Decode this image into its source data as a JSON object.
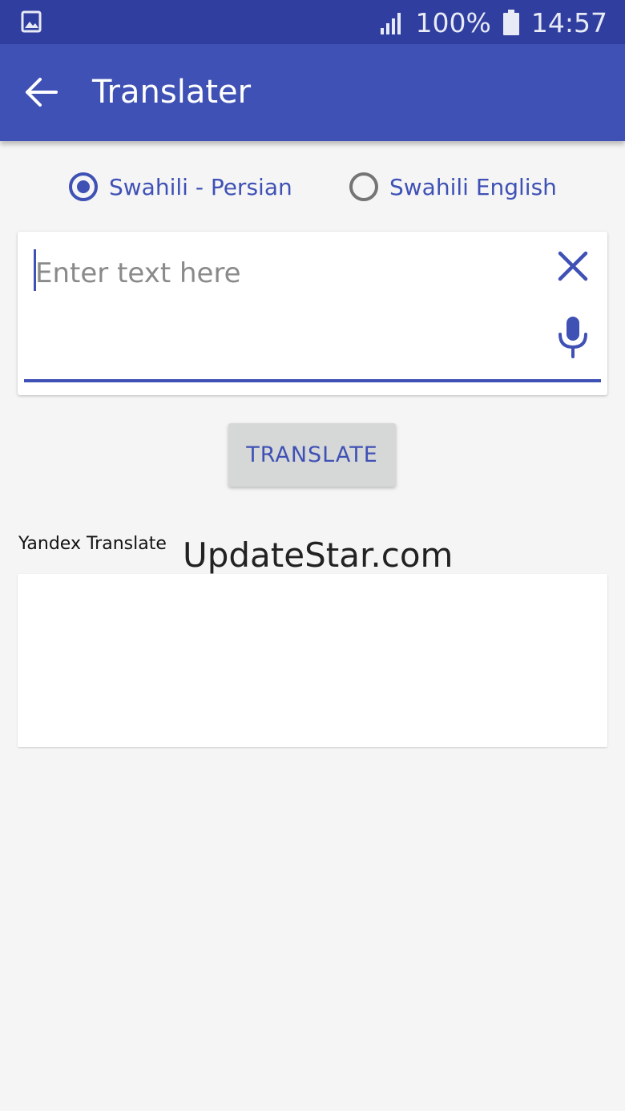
{
  "status_bar": {
    "left_icon": "image-notification-icon",
    "signal_icon": "cellular-signal-icon",
    "battery_percent": "100%",
    "battery_icon": "battery-full-icon",
    "time": "14:57"
  },
  "app_bar": {
    "back_icon": "arrow-back-icon",
    "title": "Translater",
    "color": "#3f51b5",
    "status_color": "#303f9f"
  },
  "language_options": [
    {
      "label": "Swahili - Persian",
      "selected": true
    },
    {
      "label": "Swahili English",
      "selected": false
    }
  ],
  "input": {
    "value": "",
    "placeholder": "Enter text here",
    "clear_icon": "close-icon",
    "mic_icon": "microphone-icon"
  },
  "translate_button": {
    "label": "TRANSLATE"
  },
  "provider": {
    "label": "Yandex Translate"
  },
  "watermark": {
    "text": "UpdateStar.com"
  },
  "output": {
    "value": ""
  }
}
